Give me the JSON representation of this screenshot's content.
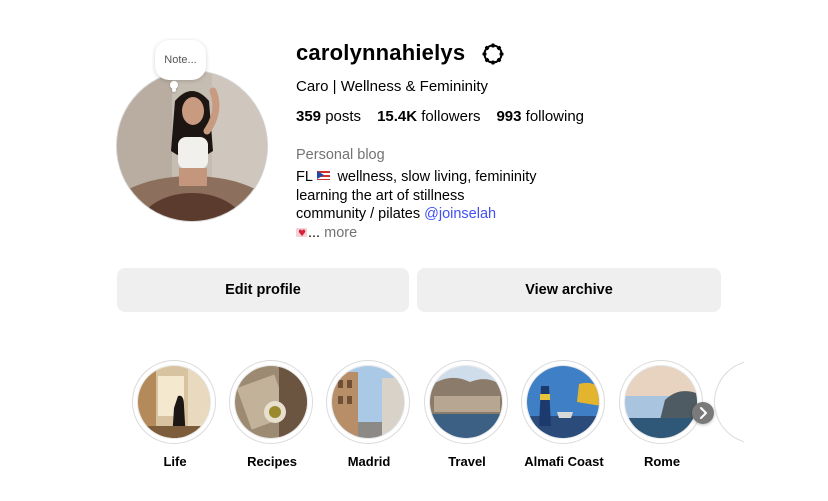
{
  "profile": {
    "username": "carolynnahielys",
    "display_name": "Caro | Wellness & Femininity",
    "note": "Note...",
    "stats": {
      "posts_count": "359",
      "posts_label": "posts",
      "followers_count": "15.4K",
      "followers_label": "followers",
      "following_count": "993",
      "following_label": "following"
    },
    "category": "Personal blog",
    "bio": {
      "line1_prefix": "FL",
      "line1_text": "wellness, slow living, femininity",
      "line2": "learning the art of stillness",
      "line3_text": "community / pilates ",
      "line3_link": "@joinselah",
      "line4_ellipsis": "... ",
      "more": "more"
    }
  },
  "buttons": {
    "edit_profile": "Edit profile",
    "view_archive": "View archive"
  },
  "highlights": [
    {
      "label": "Life"
    },
    {
      "label": "Recipes"
    },
    {
      "label": "Madrid"
    },
    {
      "label": "Travel"
    },
    {
      "label": "Almafi Coast"
    },
    {
      "label": "Rome"
    }
  ],
  "icons": {
    "settings": "gear-icon",
    "next": "chevron-right-icon"
  },
  "colors": {
    "link": "#4150f7",
    "secondary_text": "#737373",
    "button_bg": "#efefef"
  }
}
